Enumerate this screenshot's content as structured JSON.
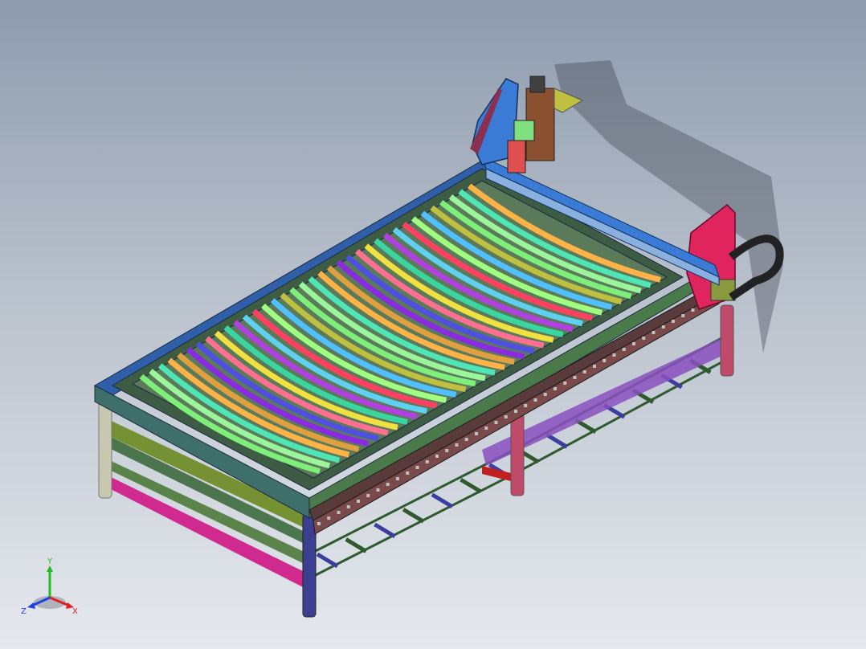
{
  "window": {
    "title": ""
  },
  "colors": {
    "background_top": "#8e9bad",
    "background_bottom": "#e6e9ee",
    "frame": "#3d5c43",
    "frame_edge_blue": "#2f5fa8",
    "gantry_right": "#e0245e",
    "gantry_left": "#3a7bd5",
    "rail": "#5a3b3b",
    "leg_front_left": "#c8c8b0",
    "leg_front_mid": "#3a3f8f",
    "leg_back": "#c04a6a",
    "cable_chain": "#222222",
    "slats": [
      "#7ef07a",
      "#9bf59a",
      "#4ee6b4",
      "#ffb347",
      "#e0a040",
      "#8a2be2",
      "#5050e0",
      "#ff6f91",
      "#f0e040",
      "#3ad6a0",
      "#b040e0",
      "#60d0f0",
      "#ff4060",
      "#a0ff80",
      "#50c0ff",
      "#c0c040"
    ]
  },
  "triad": {
    "x_label": "X",
    "y_label": "Y",
    "z_label": "Z",
    "x_color": "#e02020",
    "y_color": "#20c020",
    "z_color": "#2040e0"
  },
  "model": {
    "icon": "cnc-plasma-table-3d-model",
    "slat_count": 36
  }
}
